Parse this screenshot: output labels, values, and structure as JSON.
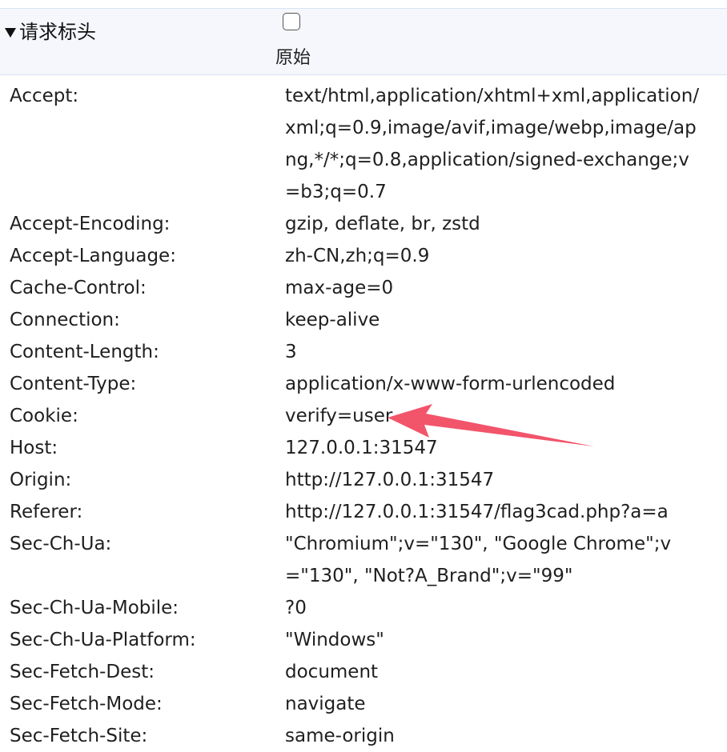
{
  "section": {
    "title": "请求标头",
    "raw_label": "原始",
    "raw_checked": false
  },
  "headers": [
    {
      "name": "Accept:",
      "value": "text/html,application/xhtml+xml,application/xml;q=0.9,image/avif,image/webp,image/apng,*/*;q=0.8,application/signed-exchange;v=b3;q=0.7"
    },
    {
      "name": "Accept-Encoding:",
      "value": "gzip, deflate, br, zstd"
    },
    {
      "name": "Accept-Language:",
      "value": "zh-CN,zh;q=0.9"
    },
    {
      "name": "Cache-Control:",
      "value": "max-age=0"
    },
    {
      "name": "Connection:",
      "value": "keep-alive"
    },
    {
      "name": "Content-Length:",
      "value": "3"
    },
    {
      "name": "Content-Type:",
      "value": "application/x-www-form-urlencoded"
    },
    {
      "name": "Cookie:",
      "value": "verify=user"
    },
    {
      "name": "Host:",
      "value": "127.0.0.1:31547"
    },
    {
      "name": "Origin:",
      "value": "http://127.0.0.1:31547"
    },
    {
      "name": "Referer:",
      "value": "http://127.0.0.1:31547/flag3cad.php?a=a"
    },
    {
      "name": "Sec-Ch-Ua:",
      "value": "\"Chromium\";v=\"130\", \"Google Chrome\";v=\"130\", \"Not?A_Brand\";v=\"99\""
    },
    {
      "name": "Sec-Ch-Ua-Mobile:",
      "value": "?0"
    },
    {
      "name": "Sec-Ch-Ua-Platform:",
      "value": "\"Windows\""
    },
    {
      "name": "Sec-Fetch-Dest:",
      "value": "document"
    },
    {
      "name": "Sec-Fetch-Mode:",
      "value": "navigate"
    },
    {
      "name": "Sec-Fetch-Site:",
      "value": "same-origin"
    }
  ],
  "annotation": {
    "arrow_color": "#f2546a",
    "points_to": "verify=user"
  }
}
